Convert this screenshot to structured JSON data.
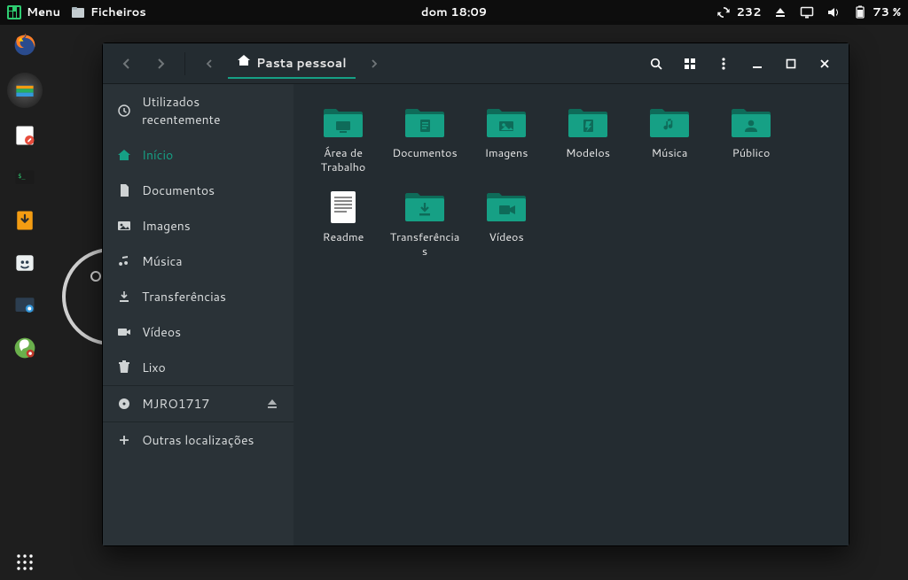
{
  "panel": {
    "menu_label": "Menu",
    "app_label": "Ficheiros",
    "clock": "dom 18:09",
    "updates_count": "232",
    "battery": "73 %"
  },
  "window": {
    "breadcrumb": "Pasta pessoal",
    "sidebar": {
      "recent": "Utilizados recentemente",
      "home": "Início",
      "documents": "Documentos",
      "images": "Imagens",
      "music": "Música",
      "downloads": "Transferências",
      "videos": "Vídeos",
      "trash": "Lixo",
      "disk": "MJRO1717",
      "other": "Outras localizações"
    },
    "files": [
      {
        "name": "Área de Trabalho",
        "type": "desktop"
      },
      {
        "name": "Documentos",
        "type": "documents"
      },
      {
        "name": "Imagens",
        "type": "images"
      },
      {
        "name": "Modelos",
        "type": "templates"
      },
      {
        "name": "Música",
        "type": "music"
      },
      {
        "name": "Público",
        "type": "public"
      },
      {
        "name": "Readme",
        "type": "text"
      },
      {
        "name": "Transferências",
        "type": "downloads"
      },
      {
        "name": "Vídeos",
        "type": "videos"
      }
    ]
  }
}
